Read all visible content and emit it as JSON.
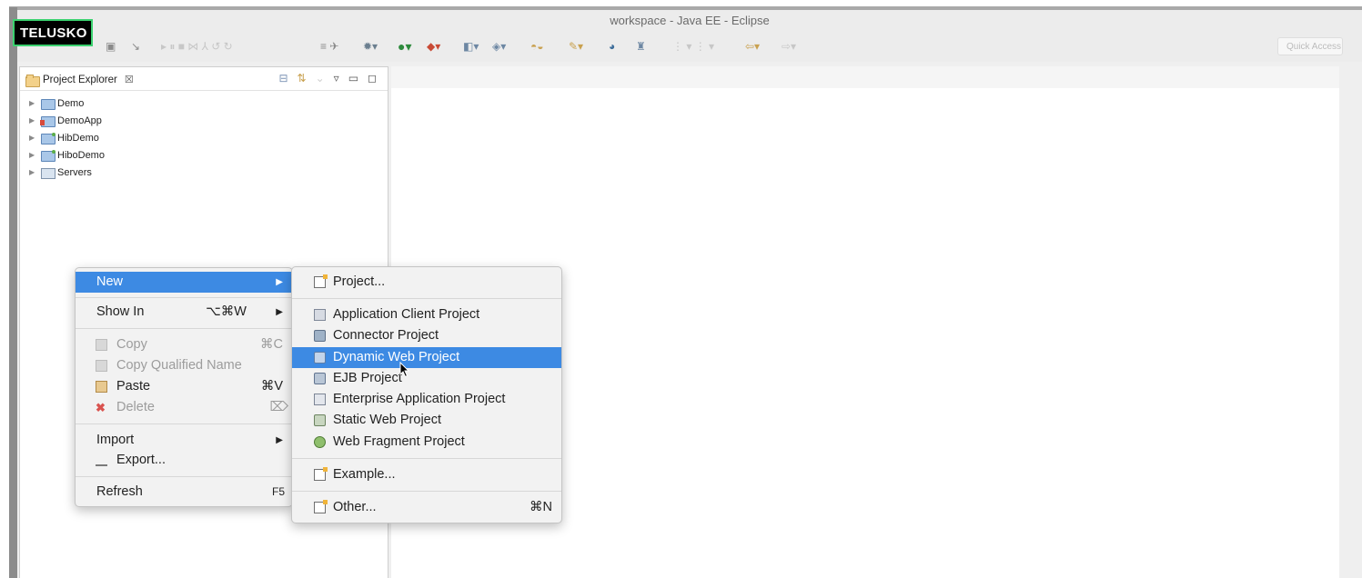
{
  "window": {
    "title": "workspace - Java EE - Eclipse"
  },
  "watermark": {
    "text": "TELUSKO"
  },
  "toolbar": {
    "quick_access_placeholder": "Quick Access"
  },
  "project_explorer": {
    "title": "Project Explorer",
    "close_glyph": "☒",
    "projects": [
      {
        "name": "Demo",
        "icon": "project-icon"
      },
      {
        "name": "DemoApp",
        "icon": "web-project-icon"
      },
      {
        "name": "HibDemo",
        "icon": "jpa-project-icon"
      },
      {
        "name": "HiboDemo",
        "icon": "jpa-project-icon"
      },
      {
        "name": "Servers",
        "icon": "folder-icon"
      }
    ]
  },
  "context_menu": {
    "new": "New",
    "show_in": "Show In",
    "show_in_shortcut": "⌥⌘W",
    "copy": "Copy",
    "copy_shortcut": "⌘C",
    "copy_qualified_name": "Copy Qualified Name",
    "paste": "Paste",
    "paste_shortcut": "⌘V",
    "delete": "Delete",
    "delete_shortcut": "⌦",
    "import": "Import",
    "export": "Export...",
    "refresh": "Refresh",
    "refresh_shortcut": "F5"
  },
  "new_submenu": {
    "project": "Project...",
    "application_client_project": "Application Client Project",
    "connector_project": "Connector Project",
    "dynamic_web_project": "Dynamic Web Project",
    "ejb_project": "EJB Project",
    "enterprise_application_project": "Enterprise Application Project",
    "static_web_project": "Static Web Project",
    "web_fragment_project": "Web Fragment Project",
    "example": "Example...",
    "other": "Other...",
    "other_shortcut": "⌘N"
  },
  "colors": {
    "selection": "#3d8ae3",
    "menu_bg": "#f2f2f2",
    "watermark_border": "#3bd16f"
  }
}
